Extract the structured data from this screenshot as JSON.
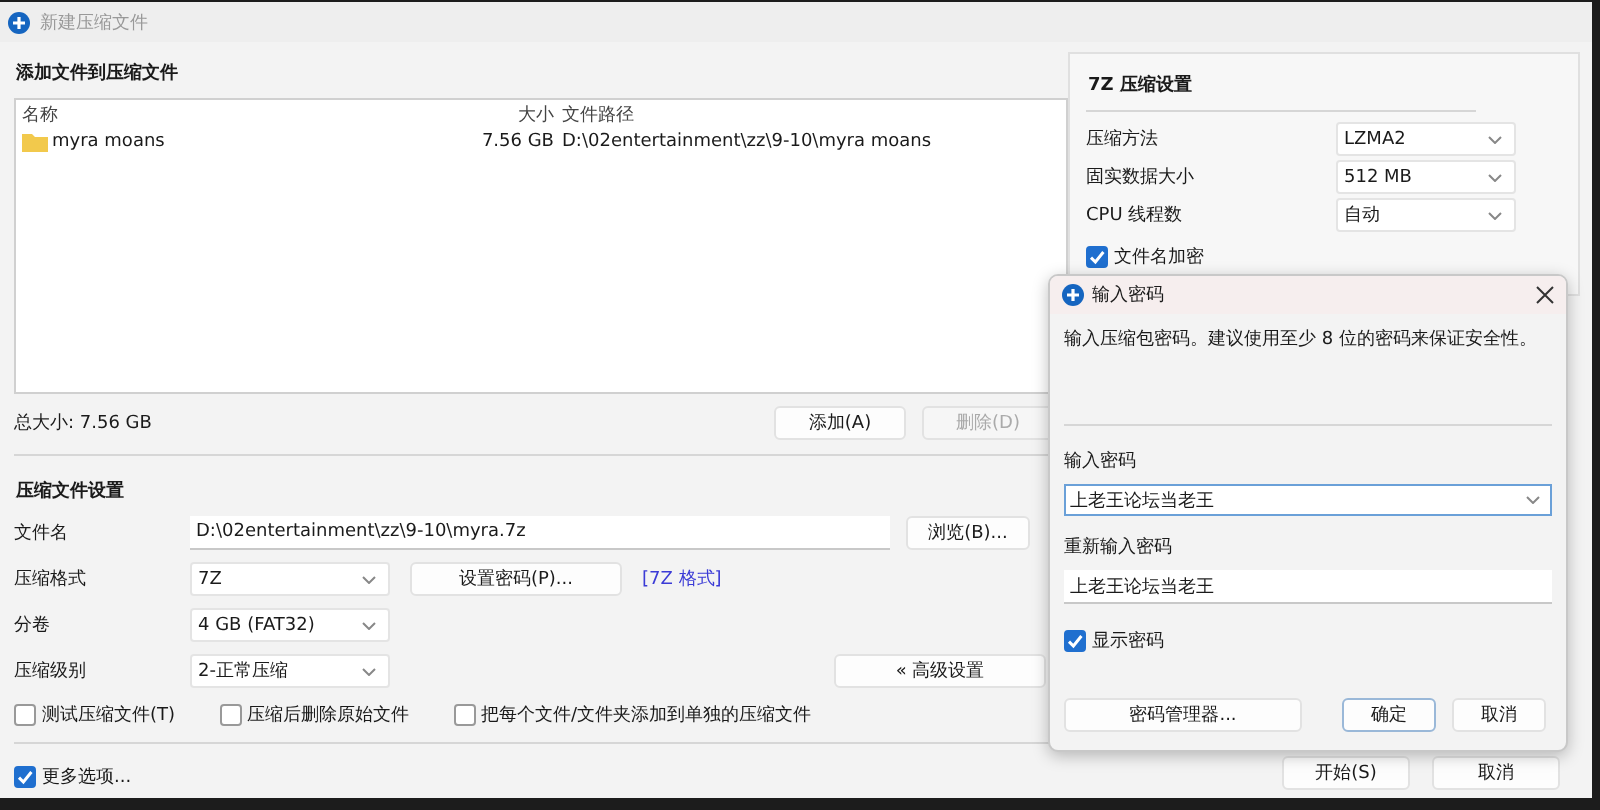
{
  "window": {
    "title": "新建压缩文件"
  },
  "files_section": {
    "heading": "添加文件到压缩文件",
    "columns": [
      "名称",
      "大小",
      "文件路径"
    ],
    "rows": [
      {
        "name": "myra moans",
        "size": "7.56 GB",
        "path": "D:\\02entertainment\\zz\\9-10\\myra moans",
        "selected": false
      }
    ],
    "total": "总大小: 7.56 GB",
    "buttons": [
      {
        "label": "添加(A)",
        "disabled": false
      },
      {
        "label": "删除(D)",
        "disabled": true
      }
    ]
  },
  "archive_settings": {
    "heading": "压缩文件设置",
    "filename": {
      "label": "文件名",
      "value": "D:\\02entertainment\\zz\\9-10\\myra.7z",
      "button": "浏览(B)..."
    },
    "format": {
      "label": "压缩格式",
      "value": "7Z",
      "button": "设置密码(P)...",
      "link": "[7Z 格式]"
    },
    "split": {
      "label": "分卷",
      "value": "4 GB (FAT32)"
    },
    "level": {
      "label": "压缩级别",
      "value": "2-正常压缩",
      "button": "« 高级设置"
    },
    "options": [
      {
        "label": "测试压缩文件(T)",
        "checked": false
      },
      {
        "label": "压缩后删除原始文件",
        "checked": false
      },
      {
        "label": "把每个文件/文件夹添加到单独的压缩文件",
        "checked": false
      }
    ],
    "more": {
      "label": "更多选项...",
      "checked": true
    }
  },
  "seven_z_settings": {
    "heading": "7Z 压缩设置",
    "rows": [
      {
        "label": "压缩方法",
        "value": "LZMA2"
      },
      {
        "label": "固实数据大小",
        "value": "512 MB"
      },
      {
        "label": "CPU 线程数",
        "value": "自动"
      }
    ],
    "encrypt_names": {
      "label": "文件名加密",
      "checked": true
    }
  },
  "buttons": [
    {
      "label": "开始(S)"
    },
    {
      "label": "取消"
    }
  ],
  "password_dialog": {
    "title": "输入密码",
    "message": "输入压缩包密码。建议使用至少 8 位的密码来保证安全性。",
    "password": {
      "label": "输入密码",
      "value": "上老王论坛当老王"
    },
    "confirm": {
      "label": "重新输入密码",
      "value": "上老王论坛当老王"
    },
    "show_password": {
      "label": "显示密码",
      "checked": true
    },
    "buttons": [
      {
        "label": "密码管理器...",
        "default": false
      },
      {
        "label": "确定",
        "default": true
      },
      {
        "label": "取消",
        "default": false
      }
    ]
  }
}
